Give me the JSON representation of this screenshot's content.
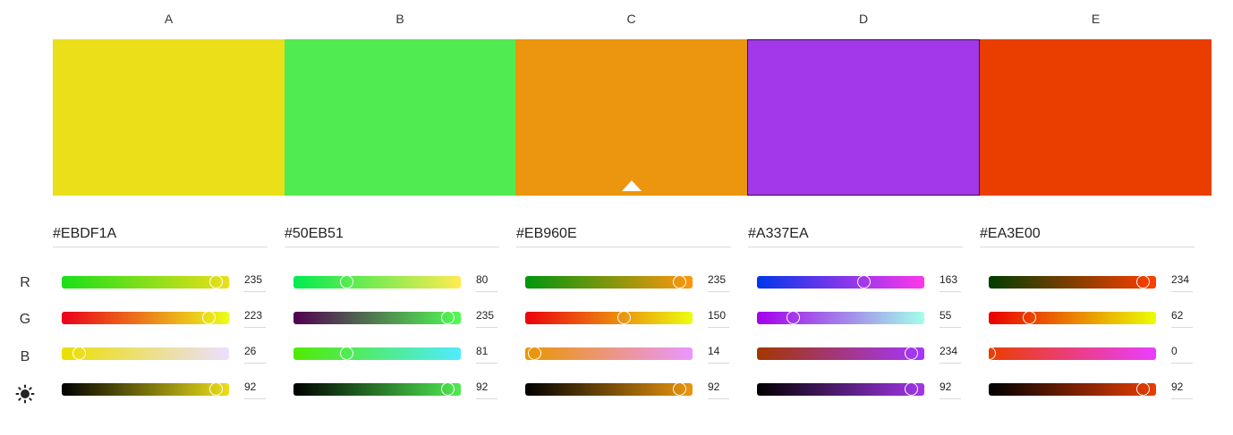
{
  "columns": [
    {
      "label": "A",
      "hex": "#EBDF1A",
      "r": "235",
      "g": "223",
      "b": "26",
      "brightness": "92",
      "r_frac": 0.922,
      "g_frac": 0.875,
      "b_frac": 0.102,
      "br_frac": 0.92,
      "r_grad": [
        "#1ADF1A",
        "#EBDF1A"
      ],
      "g_grad": [
        "#EB001A",
        "#EBFF1A"
      ],
      "b_grad": [
        "#EBDF00",
        "#EBDFFF"
      ],
      "br_grad": [
        "#000000",
        "#EBDF1A"
      ]
    },
    {
      "label": "B",
      "hex": "#50EB51",
      "r": "80",
      "g": "235",
      "b": "81",
      "brightness": "92",
      "r_frac": 0.314,
      "g_frac": 0.922,
      "b_frac": 0.318,
      "br_frac": 0.92,
      "r_grad": [
        "#00EB51",
        "#FFEB51"
      ],
      "g_grad": [
        "#500051",
        "#50FF51"
      ],
      "b_grad": [
        "#50EB00",
        "#50EBFF"
      ],
      "br_grad": [
        "#000000",
        "#50EB51"
      ]
    },
    {
      "label": "C",
      "hex": "#EB960E",
      "r": "235",
      "g": "150",
      "b": "14",
      "brightness": "92",
      "r_frac": 0.922,
      "g_frac": 0.588,
      "b_frac": 0.055,
      "br_frac": 0.92,
      "r_grad": [
        "#00960E",
        "#FF960E"
      ],
      "g_grad": [
        "#EB000E",
        "#EBFF0E"
      ],
      "b_grad": [
        "#EB9600",
        "#EB96FF"
      ],
      "br_grad": [
        "#000000",
        "#EB960E"
      ]
    },
    {
      "label": "D",
      "hex": "#A337EA",
      "r": "163",
      "g": "55",
      "b": "234",
      "brightness": "92",
      "r_frac": 0.639,
      "g_frac": 0.216,
      "b_frac": 0.918,
      "br_frac": 0.92,
      "r_grad": [
        "#0037EA",
        "#FF37EA"
      ],
      "g_grad": [
        "#A300EA",
        "#A3FFEA"
      ],
      "b_grad": [
        "#A33700",
        "#A337FF"
      ],
      "br_grad": [
        "#000000",
        "#A337EA"
      ]
    },
    {
      "label": "E",
      "hex": "#EA3E00",
      "r": "234",
      "g": "62",
      "b": "0",
      "brightness": "92",
      "r_frac": 0.918,
      "g_frac": 0.243,
      "b_frac": 0.0,
      "br_frac": 0.92,
      "r_grad": [
        "#003E00",
        "#FF3E00"
      ],
      "g_grad": [
        "#EA0000",
        "#EAFF00"
      ],
      "b_grad": [
        "#EA3E00",
        "#EA3EFF"
      ],
      "br_grad": [
        "#000000",
        "#EA3E00"
      ]
    }
  ],
  "selected_column": "C",
  "highlighted_column": "D",
  "row_labels": {
    "r": "R",
    "g": "G",
    "b": "B"
  },
  "brightness_icon": "sun-icon"
}
